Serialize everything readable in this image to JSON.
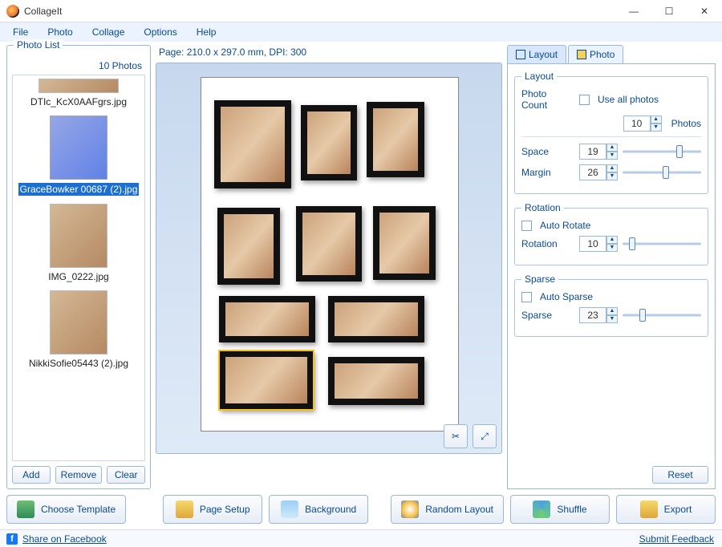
{
  "title": "CollageIt",
  "menu": [
    "File",
    "Photo",
    "Collage",
    "Options",
    "Help"
  ],
  "photolist": {
    "legend": "Photo List",
    "count_label": "10 Photos",
    "items": [
      {
        "name": "DTIc_KcX0AAFgrs.jpg",
        "selected": false
      },
      {
        "name": "GraceBowker 00687 (2).jpg",
        "selected": true
      },
      {
        "name": "IMG_0222.jpg",
        "selected": false
      },
      {
        "name": "NikkiSofie05443 (2).jpg",
        "selected": false
      }
    ],
    "buttons": {
      "add": "Add",
      "remove": "Remove",
      "clear": "Clear"
    }
  },
  "page_info": "Page: 210.0 x 297.0 mm, DPI: 300",
  "tabs": {
    "layout": "Layout",
    "photo": "Photo",
    "active": "layout"
  },
  "layout": {
    "group_label": "Layout",
    "photo_count_label": "Photo Count",
    "use_all_label": "Use all photos",
    "photo_count": "10",
    "photos_suffix": "Photos",
    "space_label": "Space",
    "space": "19",
    "margin_label": "Margin",
    "margin": "26"
  },
  "rotation": {
    "group_label": "Rotation",
    "auto_label": "Auto Rotate",
    "rotation_label": "Rotation",
    "value": "10"
  },
  "sparse": {
    "group_label": "Sparse",
    "auto_label": "Auto Sparse",
    "sparse_label": "Sparse",
    "value": "23"
  },
  "reset": "Reset",
  "bottom": {
    "choose_template": "Choose Template",
    "page_setup": "Page Setup",
    "background": "Background",
    "random_layout": "Random Layout",
    "shuffle": "Shuffle",
    "export": "Export"
  },
  "status": {
    "share": "Share on Facebook",
    "feedback": "Submit Feedback"
  }
}
